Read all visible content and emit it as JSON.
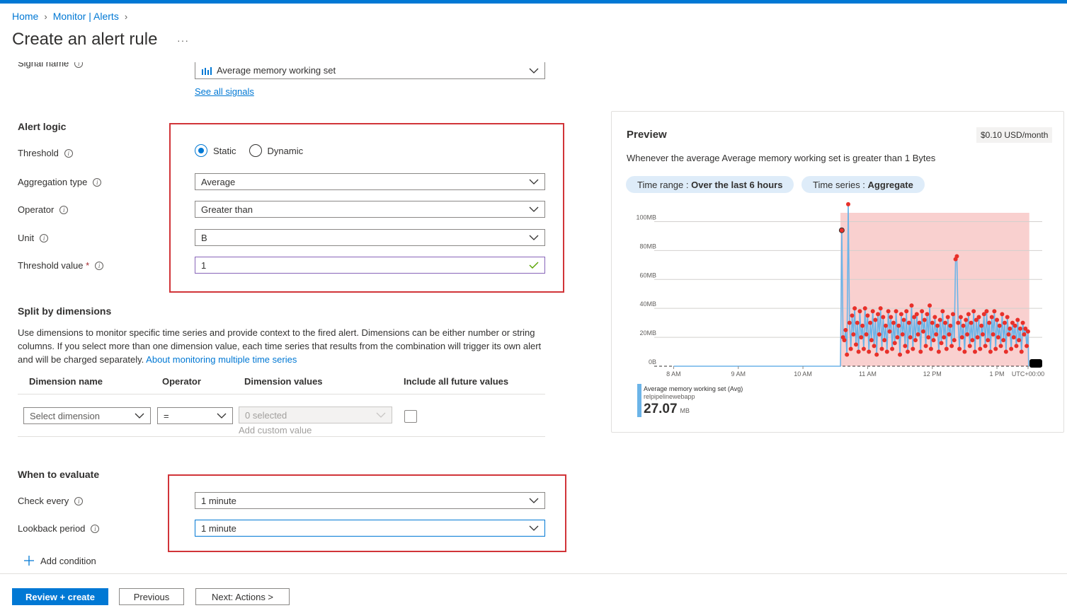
{
  "breadcrumb": {
    "home": "Home",
    "monitor": "Monitor | Alerts"
  },
  "page": {
    "title": "Create an alert rule",
    "more": "···"
  },
  "signal": {
    "label": "Signal name",
    "value": "Average memory working set",
    "see_all": "See all signals"
  },
  "alert_logic": {
    "heading": "Alert logic",
    "threshold_label": "Threshold",
    "static_label": "Static",
    "dynamic_label": "Dynamic",
    "threshold_selected": "Static",
    "aggregation_label": "Aggregation type",
    "aggregation_value": "Average",
    "operator_label": "Operator",
    "operator_value": "Greater than",
    "unit_label": "Unit",
    "unit_value": "B",
    "threshold_value_label": "Threshold value",
    "required_mark": "*",
    "threshold_value": "1"
  },
  "split": {
    "heading": "Split by dimensions",
    "description": "Use dimensions to monitor specific time series and provide context to the fired alert. Dimensions can be either number or string columns. If you select more than one dimension value, each time series that results from the combination will trigger its own alert and will be charged separately.",
    "link": "About monitoring multiple time series",
    "columns": [
      "Dimension name",
      "Operator",
      "Dimension values",
      "Include all future values"
    ],
    "dimension_placeholder": "Select dimension",
    "operator_value": "=",
    "values_placeholder": "0 selected",
    "add_custom": "Add custom value"
  },
  "evaluate": {
    "heading": "When to evaluate",
    "check_every_label": "Check every",
    "check_every_value": "1 minute",
    "lookback_label": "Lookback period",
    "lookback_value": "1 minute",
    "add_condition": "Add condition"
  },
  "preview": {
    "heading": "Preview",
    "price": "$0.10 USD/month",
    "summary": "Whenever the average Average memory working set is greater than 1 Bytes",
    "time_range_label": "Time range : ",
    "time_range_value": "Over the last 6 hours",
    "time_series_label": "Time series : ",
    "time_series_value": "Aggregate",
    "legend_name": "Average memory working set (Avg)",
    "legend_resource": "relpipelinewebapp",
    "legend_value": "27.07",
    "legend_unit": "MB"
  },
  "footer": {
    "review": "Review + create",
    "previous": "Previous",
    "next": "Next: Actions >"
  },
  "colors": {
    "accent": "#0078d4",
    "highlight_box": "#d13438",
    "series": "#6cb4e8",
    "threshold_area": "#f9d0cf",
    "points": "#e8302a"
  },
  "chart_data": {
    "type": "line",
    "title": "",
    "xlabel": "",
    "ylabel": "",
    "x_ticks": [
      "8 AM",
      "9 AM",
      "10 AM",
      "11 AM",
      "12 PM",
      "1 PM",
      "UTC+00:00"
    ],
    "y_ticks": [
      "0B",
      "20MB",
      "40MB",
      "60MB",
      "80MB",
      "100MB"
    ],
    "ylim": [
      0,
      110
    ],
    "xlim": [
      7.7,
      13.7
    ],
    "threshold_band_x": [
      10.58,
      13.5
    ],
    "series": [
      {
        "name": "Average memory working set (Avg)",
        "x": [
          10.6,
          10.62,
          10.64,
          10.66,
          10.68,
          10.7,
          10.72,
          10.74,
          10.76,
          10.78,
          10.8,
          10.82,
          10.84,
          10.86,
          10.88,
          10.9,
          10.92,
          10.94,
          10.96,
          10.98,
          11.0,
          11.02,
          11.04,
          11.06,
          11.08,
          11.1,
          11.12,
          11.14,
          11.16,
          11.18,
          11.2,
          11.22,
          11.24,
          11.26,
          11.28,
          11.3,
          11.32,
          11.34,
          11.36,
          11.38,
          11.4,
          11.42,
          11.44,
          11.46,
          11.48,
          11.5,
          11.52,
          11.54,
          11.56,
          11.58,
          11.6,
          11.62,
          11.64,
          11.66,
          11.68,
          11.7,
          11.72,
          11.74,
          11.76,
          11.78,
          11.8,
          11.82,
          11.84,
          11.86,
          11.88,
          11.9,
          11.92,
          11.94,
          11.96,
          11.98,
          12.0,
          12.02,
          12.04,
          12.06,
          12.08,
          12.1,
          12.12,
          12.14,
          12.16,
          12.18,
          12.2,
          12.22,
          12.24,
          12.26,
          12.28,
          12.3,
          12.32,
          12.34,
          12.36,
          12.38,
          12.4,
          12.42,
          12.44,
          12.46,
          12.48,
          12.5,
          12.52,
          12.54,
          12.56,
          12.58,
          12.6,
          12.62,
          12.64,
          12.66,
          12.68,
          12.7,
          12.72,
          12.74,
          12.76,
          12.78,
          12.8,
          12.82,
          12.84,
          12.86,
          12.88,
          12.9,
          12.92,
          12.94,
          12.96,
          12.98,
          13.0,
          13.02,
          13.04,
          13.06,
          13.08,
          13.1,
          13.12,
          13.14,
          13.16,
          13.18,
          13.2,
          13.22,
          13.24,
          13.26,
          13.28,
          13.3,
          13.32,
          13.34,
          13.36,
          13.38,
          13.4,
          13.42,
          13.44,
          13.46,
          13.48
        ],
        "values": [
          94,
          20,
          18,
          25,
          8,
          112,
          30,
          12,
          35,
          22,
          40,
          15,
          30,
          10,
          38,
          20,
          28,
          12,
          40,
          22,
          35,
          10,
          30,
          18,
          38,
          14,
          32,
          8,
          36,
          22,
          40,
          12,
          34,
          18,
          28,
          10,
          38,
          24,
          34,
          12,
          30,
          16,
          38,
          20,
          28,
          8,
          36,
          22,
          32,
          14,
          38,
          10,
          30,
          20,
          42,
          12,
          34,
          18,
          36,
          22,
          30,
          10,
          38,
          24,
          32,
          14,
          36,
          20,
          42,
          12,
          30,
          18,
          34,
          22,
          28,
          10,
          32,
          16,
          38,
          20,
          30,
          12,
          34,
          22,
          28,
          14,
          36,
          18,
          74,
          76,
          30,
          12,
          34,
          20,
          28,
          10,
          32,
          22,
          36,
          14,
          30,
          18,
          38,
          10,
          32,
          20,
          34,
          12,
          28,
          22,
          36,
          14,
          38,
          18,
          30,
          10,
          34,
          22,
          38,
          12,
          32,
          20,
          28,
          14,
          36,
          18,
          30,
          10,
          34,
          22,
          26,
          12,
          30,
          20,
          28,
          14,
          32,
          18,
          26,
          10,
          30,
          22,
          26,
          14,
          24
        ]
      }
    ]
  }
}
